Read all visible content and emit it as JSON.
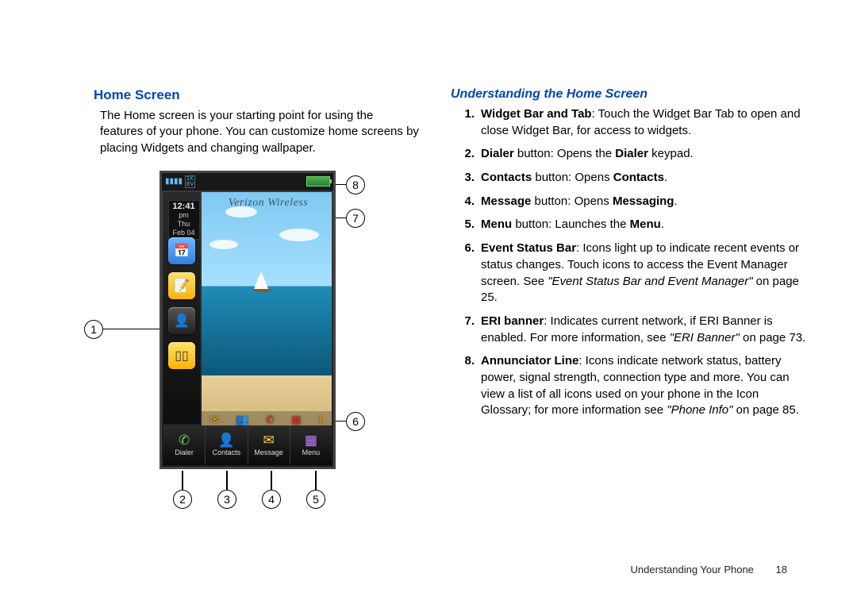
{
  "left": {
    "heading": "Home Screen",
    "paragraph": "The Home screen is your starting point for using the features of your phone.  You can customize home screens by placing Widgets and changing wallpaper."
  },
  "phone": {
    "clock_time": "12:41",
    "clock_ampm": "pm",
    "clock_day": "Thu",
    "clock_date": "Feb 04",
    "eri_text": "Verizon Wireless",
    "dock": {
      "dialer": "Dialer",
      "contacts": "Contacts",
      "message": "Message",
      "menu": "Menu"
    }
  },
  "callouts": {
    "c1": "1",
    "c2": "2",
    "c3": "3",
    "c4": "4",
    "c5": "5",
    "c6": "6",
    "c7": "7",
    "c8": "8"
  },
  "right": {
    "heading": "Understanding the Home Screen",
    "items": [
      {
        "n": "1.",
        "bold": "Widget Bar and Tab",
        "rest": ": Touch the Widget Bar Tab to open and close Widget Bar, for access to widgets."
      },
      {
        "n": "2.",
        "bold": "Dialer",
        "mid": " button: Opens the ",
        "bold2": "Dialer",
        "rest2": " keypad."
      },
      {
        "n": "3.",
        "bold": "Contacts",
        "mid": " button: Opens ",
        "bold2": "Contacts",
        "rest2": "."
      },
      {
        "n": "4.",
        "bold": "Message",
        "mid": " button: Opens ",
        "bold2": "Messaging",
        "rest2": "."
      },
      {
        "n": "5.",
        "bold": "Menu",
        "mid": " button: Launches the ",
        "bold2": "Menu",
        "rest2": "."
      },
      {
        "n": "6.",
        "bold": "Event Status Bar",
        "rest": ": Icons light up to indicate recent events or status changes. Touch icons to access the Event Manager screen. See ",
        "ital": "\"Event Status Bar and Event Manager\"",
        "rest3": " on page 25."
      },
      {
        "n": "7.",
        "bold": "ERI banner",
        "rest": ": Indicates current network, if ERI Banner is enabled.  For more information, see ",
        "ital": "\"ERI Banner\"",
        "rest3": " on page 73."
      },
      {
        "n": "8.",
        "bold": "Annunciator Line",
        "rest": ":  Icons indicate network status, battery power, signal strength, connection type and more. You can view a list of all icons used on your phone in the Icon Glossary; for more information see ",
        "ital": "\"Phone Info\"",
        "rest3": " on page 85."
      }
    ]
  },
  "footer": {
    "section": "Understanding Your Phone",
    "page": "18"
  }
}
